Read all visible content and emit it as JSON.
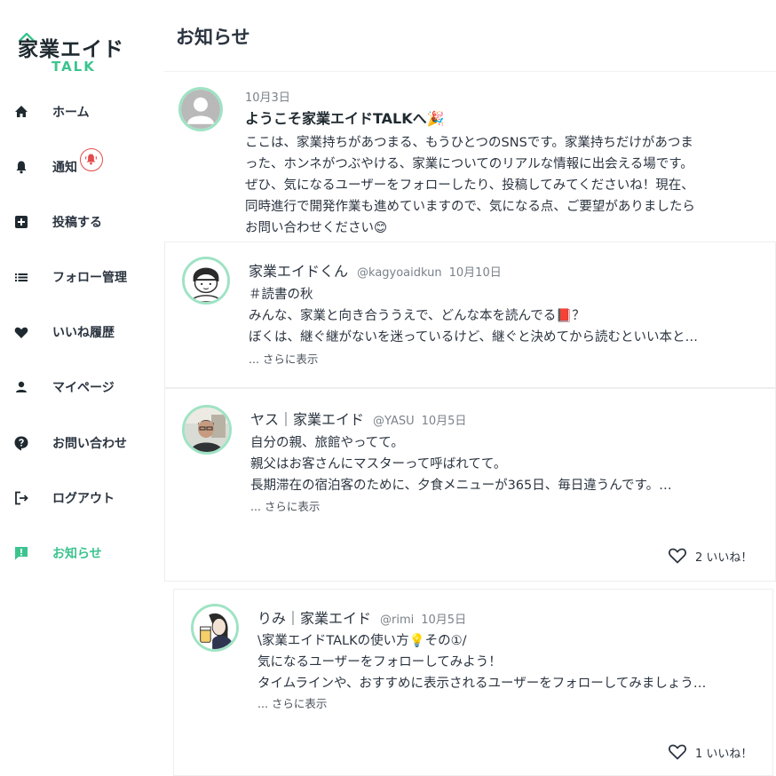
{
  "app": {
    "logo_text": "家業エイド",
    "logo_sub": "TALK"
  },
  "colors": {
    "accent": "#3cc48f",
    "text": "#2b3440",
    "muted": "#7a828a",
    "badge": "#e34c4c",
    "avatar_ring": "#9fe3c4"
  },
  "sidebar": {
    "items": [
      {
        "label": "ホーム",
        "icon": "home-icon"
      },
      {
        "label": "通知",
        "icon": "bell-icon"
      },
      {
        "label": "投稿する",
        "icon": "plus-square-icon"
      },
      {
        "label": "フォロー管理",
        "icon": "list-icon"
      },
      {
        "label": "いいね履歴",
        "icon": "heart-icon"
      },
      {
        "label": "マイページ",
        "icon": "person-icon"
      },
      {
        "label": "お問い合わせ",
        "icon": "help-icon"
      },
      {
        "label": "ログアウト",
        "icon": "logout-icon"
      },
      {
        "label": "お知らせ",
        "icon": "announcement-icon",
        "active": true
      }
    ]
  },
  "header": {
    "title": "お知らせ"
  },
  "announcement": {
    "date": "10月3日",
    "title": "ようこそ家業エイドTALKへ🎉",
    "lines": [
      "ここは、家業持ちがあつまる、もうひとつのSNSです。家業持ちだけがあつま",
      "った、ホンネがつぶやける、家業についてのリアルな情報に出会える場です。",
      "ぜひ、気になるユーザーをフォローしたり、投稿してみてくださいね！現在、",
      "同時進行で開発作業も進めていますので、気になる点、ご要望がありましたら",
      "お問い合わせください😊"
    ]
  },
  "posts": [
    {
      "author": "家業エイドくん",
      "handle": "@kagyoaidkun",
      "date": "10月10日",
      "lines": [
        "＃読書の秋",
        "みんな、家業と向き合ううえで、どんな本を読んでる📕？",
        "ぼくは、継ぐ継がないを迷っているけど、継ぐと決めてから読むといい本と…"
      ],
      "more": "... さらに表示"
    },
    {
      "author": "ヤス｜家業エイド",
      "handle": "@YASU",
      "date": "10月5日",
      "lines": [
        "自分の親、旅館やってて。",
        "親父はお客さんにマスターって呼ばれてて。",
        "長期滞在の宿泊客のために、夕食メニューが365日、毎日違うんです。…"
      ],
      "more": "... さらに表示",
      "likes": "2 いいね！"
    },
    {
      "author": "りみ｜家業エイド",
      "handle": "@rimi",
      "date": "10月5日",
      "lines": [
        "\\家業エイドTALKの使い方💡その①/",
        "気になるユーザーをフォローしてみよう！",
        "タイムラインや、おすすめに表示されるユーザーをフォローしてみましょう…"
      ],
      "more": "... さらに表示",
      "likes": "1 いいね！"
    }
  ]
}
